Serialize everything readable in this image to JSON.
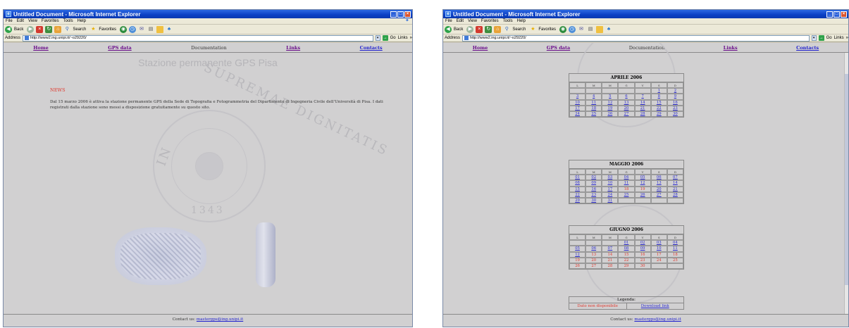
{
  "window_title": "Untitled Document - Microsoft Internet Explorer",
  "menu": [
    "File",
    "Edit",
    "View",
    "Favorites",
    "Tools",
    "Help"
  ],
  "toolbar": {
    "back_label": "Back",
    "search_label": "Search",
    "favorites_label": "Favorites"
  },
  "address": {
    "label": "Address",
    "url": "http://www2.ing.unipi.it/~o29220/",
    "go_label": "Go",
    "links_label": "Links"
  },
  "nav": {
    "home": "Home",
    "gps_data": "GPS data",
    "documentation": "Documentation",
    "links": "Links",
    "contacts": "Contacts"
  },
  "left_page": {
    "title": "Stazione permanente GPS Pisa",
    "news_heading": "NEWS",
    "news_text": "Dal 15 marzo 2006 è attiva la stazione permanente GPS della Sede di Topografia e Fotogrammetria del Dipartimento di Ingegneria Civile dell'Università di Pisa. I dati registrati dalla stazione sono messi a disposizione gratuitamente su questo sito.",
    "seal_text_1": "SUPREMAE DIGNITATIS",
    "seal_text_2": "IN",
    "seal_year": "1343"
  },
  "footer": {
    "contact_label": "Contact us:",
    "contact_email": "mastergps@ing.unipi.it"
  },
  "calendars": [
    {
      "title": "APRILE 2006",
      "days_header": [
        "L",
        "M",
        "M",
        "G",
        "V",
        "S",
        "D"
      ],
      "weeks": [
        [
          {
            "t": ""
          },
          {
            "t": ""
          },
          {
            "t": ""
          },
          {
            "t": ""
          },
          {
            "t": ""
          },
          {
            "t": "1",
            "s": "link"
          },
          {
            "t": "2",
            "s": "link"
          }
        ],
        [
          {
            "t": "3",
            "s": "link"
          },
          {
            "t": "4",
            "s": "link"
          },
          {
            "t": "5",
            "s": "link"
          },
          {
            "t": "6",
            "s": "link"
          },
          {
            "t": "7",
            "s": "link"
          },
          {
            "t": "8",
            "s": "link"
          },
          {
            "t": "9",
            "s": "link"
          }
        ],
        [
          {
            "t": "10",
            "s": "link"
          },
          {
            "t": "11",
            "s": "link"
          },
          {
            "t": "12",
            "s": "link"
          },
          {
            "t": "13",
            "s": "link"
          },
          {
            "t": "14",
            "s": "link"
          },
          {
            "t": "15",
            "s": "link"
          },
          {
            "t": "16",
            "s": "link"
          }
        ],
        [
          {
            "t": "17",
            "s": "link"
          },
          {
            "t": "18",
            "s": "link"
          },
          {
            "t": "19",
            "s": "link"
          },
          {
            "t": "20",
            "s": "link"
          },
          {
            "t": "21",
            "s": "link"
          },
          {
            "t": "22",
            "s": "link"
          },
          {
            "t": "23",
            "s": "link"
          }
        ],
        [
          {
            "t": "24",
            "s": "link"
          },
          {
            "t": "25",
            "s": "link"
          },
          {
            "t": "26",
            "s": "link"
          },
          {
            "t": "27",
            "s": "link"
          },
          {
            "t": "28",
            "s": "link"
          },
          {
            "t": "29",
            "s": "link"
          },
          {
            "t": "30",
            "s": "link"
          }
        ]
      ]
    },
    {
      "title": "MAGGIO 2006",
      "days_header": [
        "L",
        "M",
        "M",
        "G",
        "V",
        "S",
        "D"
      ],
      "weeks": [
        [
          {
            "t": "01",
            "s": "link"
          },
          {
            "t": "02",
            "s": "link"
          },
          {
            "t": "03",
            "s": "link"
          },
          {
            "t": "04",
            "s": "link"
          },
          {
            "t": "05",
            "s": "link"
          },
          {
            "t": "06",
            "s": "link"
          },
          {
            "t": "07",
            "s": "link"
          }
        ],
        [
          {
            "t": "08",
            "s": "link"
          },
          {
            "t": "09",
            "s": "link"
          },
          {
            "t": "10",
            "s": "link"
          },
          {
            "t": "11",
            "s": "link"
          },
          {
            "t": "12",
            "s": "link"
          },
          {
            "t": "13",
            "s": "link"
          },
          {
            "t": "14",
            "s": "link"
          }
        ],
        [
          {
            "t": "15",
            "s": "link"
          },
          {
            "t": "16",
            "s": "link"
          },
          {
            "t": "17",
            "s": "link"
          },
          {
            "t": "18",
            "s": "na"
          },
          {
            "t": "19",
            "s": "na"
          },
          {
            "t": "20",
            "s": "link"
          },
          {
            "t": "21",
            "s": "link"
          }
        ],
        [
          {
            "t": "22",
            "s": "link"
          },
          {
            "t": "23",
            "s": "link"
          },
          {
            "t": "24",
            "s": "link"
          },
          {
            "t": "25",
            "s": "link"
          },
          {
            "t": "26",
            "s": "link"
          },
          {
            "t": "27",
            "s": "link"
          },
          {
            "t": "28",
            "s": "link"
          }
        ],
        [
          {
            "t": "29",
            "s": "link"
          },
          {
            "t": "30",
            "s": "link"
          },
          {
            "t": "31",
            "s": "link"
          },
          {
            "t": ""
          },
          {
            "t": ""
          },
          {
            "t": ""
          },
          {
            "t": ""
          }
        ]
      ]
    },
    {
      "title": "GIUGNO 2006",
      "days_header": [
        "L",
        "M",
        "M",
        "G",
        "V",
        "S",
        "D"
      ],
      "weeks": [
        [
          {
            "t": ""
          },
          {
            "t": ""
          },
          {
            "t": ""
          },
          {
            "t": "01",
            "s": "link"
          },
          {
            "t": "02",
            "s": "link"
          },
          {
            "t": "03",
            "s": "link"
          },
          {
            "t": "04",
            "s": "link"
          }
        ],
        [
          {
            "t": "05",
            "s": "link"
          },
          {
            "t": "06",
            "s": "link"
          },
          {
            "t": "07",
            "s": "link"
          },
          {
            "t": "08",
            "s": "link"
          },
          {
            "t": "09",
            "s": "link"
          },
          {
            "t": "10",
            "s": "link"
          },
          {
            "t": "11",
            "s": "link"
          }
        ],
        [
          {
            "t": "12",
            "s": "link"
          },
          {
            "t": "13",
            "s": "na"
          },
          {
            "t": "14",
            "s": "na"
          },
          {
            "t": "15",
            "s": "na"
          },
          {
            "t": "16",
            "s": "na"
          },
          {
            "t": "17",
            "s": "na"
          },
          {
            "t": "18",
            "s": "na"
          }
        ],
        [
          {
            "t": "19",
            "s": "na"
          },
          {
            "t": "20",
            "s": "na"
          },
          {
            "t": "21",
            "s": "na"
          },
          {
            "t": "22",
            "s": "na"
          },
          {
            "t": "23",
            "s": "na"
          },
          {
            "t": "24",
            "s": "na"
          },
          {
            "t": "25",
            "s": "na"
          }
        ],
        [
          {
            "t": "26",
            "s": "na"
          },
          {
            "t": "27",
            "s": "na"
          },
          {
            "t": "28",
            "s": "na"
          },
          {
            "t": "29",
            "s": "na"
          },
          {
            "t": "30",
            "s": "na"
          },
          {
            "t": ""
          },
          {
            "t": ""
          }
        ]
      ]
    }
  ],
  "legend": {
    "title": "Legenda:",
    "not_available": "Dato non disponibile",
    "download": "Download link"
  },
  "colors": {
    "not_available": "#e03a2f",
    "link": "#2a2ad0"
  }
}
